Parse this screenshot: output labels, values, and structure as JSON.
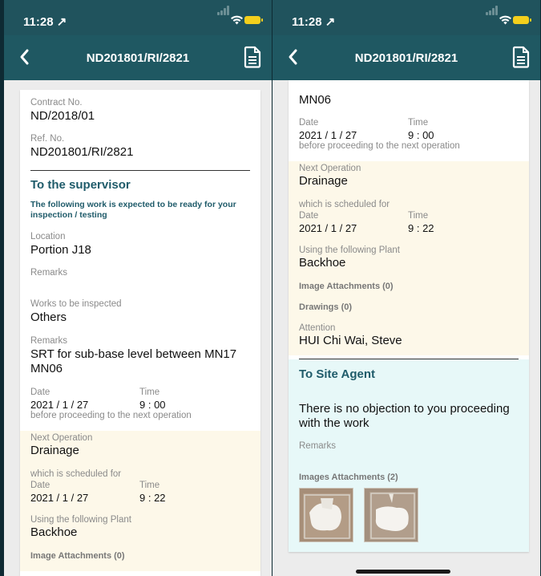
{
  "status": {
    "time": "11:28 ↗"
  },
  "header": {
    "title": "ND201801/RI/2821"
  },
  "left": {
    "contract_label": "Contract No.",
    "contract_value": "ND/2018/01",
    "ref_label": "Ref. No.",
    "ref_value": "ND201801/RI/2821",
    "supervisor_title": "To the supervisor",
    "supervisor_note": "The following work is expected to be ready for your inspection / testing",
    "location_label": "Location",
    "location_value": "Portion J18",
    "remarks1_label": "Remarks",
    "works_label": "Works to be inspected",
    "works_value": "Others",
    "remarks2_label": "Remarks",
    "remarks2_value": "SRT for sub-base level between MN17 MN06",
    "date_label": "Date",
    "date_value": "2021 / 1 / 27",
    "time_label": "Time",
    "time_value": "9 : 00",
    "before_text": "before proceeding to the next operation",
    "next_op_label": "Next Operation",
    "next_op_value": "Drainage",
    "scheduled_label": "which is scheduled for",
    "date2_label": "Date",
    "date2_value": "2021 / 1 / 27",
    "time2_label": "Time",
    "time2_value": "9 : 22",
    "plant_label": "Using the following Plant",
    "plant_value": "Backhoe",
    "image_attachments": "Image Attachments (0)"
  },
  "right": {
    "top_value": "MN06",
    "date_label": "Date",
    "date_value": "2021 / 1 / 27",
    "time_label": "Time",
    "time_value": "9 : 00",
    "before_text": "before proceeding to the next operation",
    "next_op_label": "Next Operation",
    "next_op_value": "Drainage",
    "scheduled_label": "which is scheduled for",
    "date2_label": "Date",
    "date2_value": "2021 / 1 / 27",
    "time2_label": "Time",
    "time2_value": "9 : 22",
    "plant_label": "Using the following Plant",
    "plant_value": "Backhoe",
    "image_attachments": "Image Attachments (0)",
    "drawings": "Drawings (0)",
    "attention_label": "Attention",
    "attention_value": "HUI Chi Wai, Steve",
    "site_agent_title": "To Site Agent",
    "no_objection": "There is no objection to you proceeding with the work",
    "remarks_label": "Remarks",
    "images_attachments": "Images Attachments (2)"
  },
  "icons": [
    "back-chevron-icon",
    "document-icon",
    "location-arrow-icon",
    "wifi-icon",
    "battery-icon",
    "cellular-signal-icon"
  ],
  "colors": {
    "nav": "#1f5862",
    "status": "#20535d",
    "accent_text": "#1f5b6a",
    "yellow_section": "#fdf8e9",
    "cyan_section": "#e7f8f8",
    "battery": "#f4cf1c"
  }
}
